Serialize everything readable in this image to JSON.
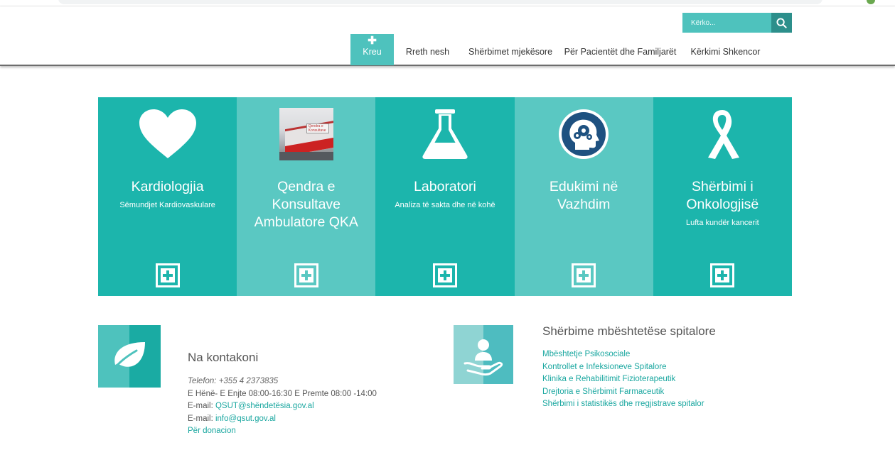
{
  "search": {
    "placeholder": "Kërko..."
  },
  "nav": {
    "home_label": "Kreu",
    "items": [
      "Rreth nesh",
      "Shërbimet mjekësore",
      "Për Pacientët dhe Familjarët",
      "Kërkimi Shkencor"
    ]
  },
  "tiles": [
    {
      "title": "Kardiologjia",
      "subtitle": "Sëmundjet Kardiovaskulare",
      "icon": "heart-icon"
    },
    {
      "title": "Qendra e Konsultave Ambulatore QKA",
      "subtitle": "",
      "icon": "building-photo"
    },
    {
      "title": "Laboratori",
      "subtitle": "Analiza të sakta dhe në kohë",
      "icon": "flask-icon"
    },
    {
      "title": "Edukimi në Vazhdim",
      "subtitle": "",
      "icon": "brain-gears-icon"
    },
    {
      "title": "Shërbimi i Onkologjisë",
      "subtitle": "Lufta kundër kancerit",
      "icon": "ribbon-icon"
    }
  ],
  "contact": {
    "heading": "Na kontakoni",
    "phone": "Telefon: +355 4 2373835",
    "hours": "E Hënë- E Enjte 08:00-16:30 E Premte 08:00 -14:00",
    "email_label": "E-mail: ",
    "email1": "QSUT@shëndetësia.gov.al",
    "email2": "info@qsut.gov.al",
    "donation": "Për donacion"
  },
  "services": {
    "heading": "Shërbime mbështetëse spitalore",
    "links": [
      "Mbështetje Psikosociale",
      "Kontrollet e Infeksioneve Spitalore",
      "Klinika e Rehabilitimit Fizioterapeutik",
      "Drejtoria e Shërbimit Farmaceutik",
      "Shërbimi i statistikës dhe rregjistrave spitalor"
    ]
  },
  "colors": {
    "teal_dark": "#1cb5ac",
    "teal_light": "#5ac8c2",
    "search_button": "#2c8f8b",
    "link": "#1aa7a0"
  },
  "photo_sign_text": "Qendra e Konsultave"
}
